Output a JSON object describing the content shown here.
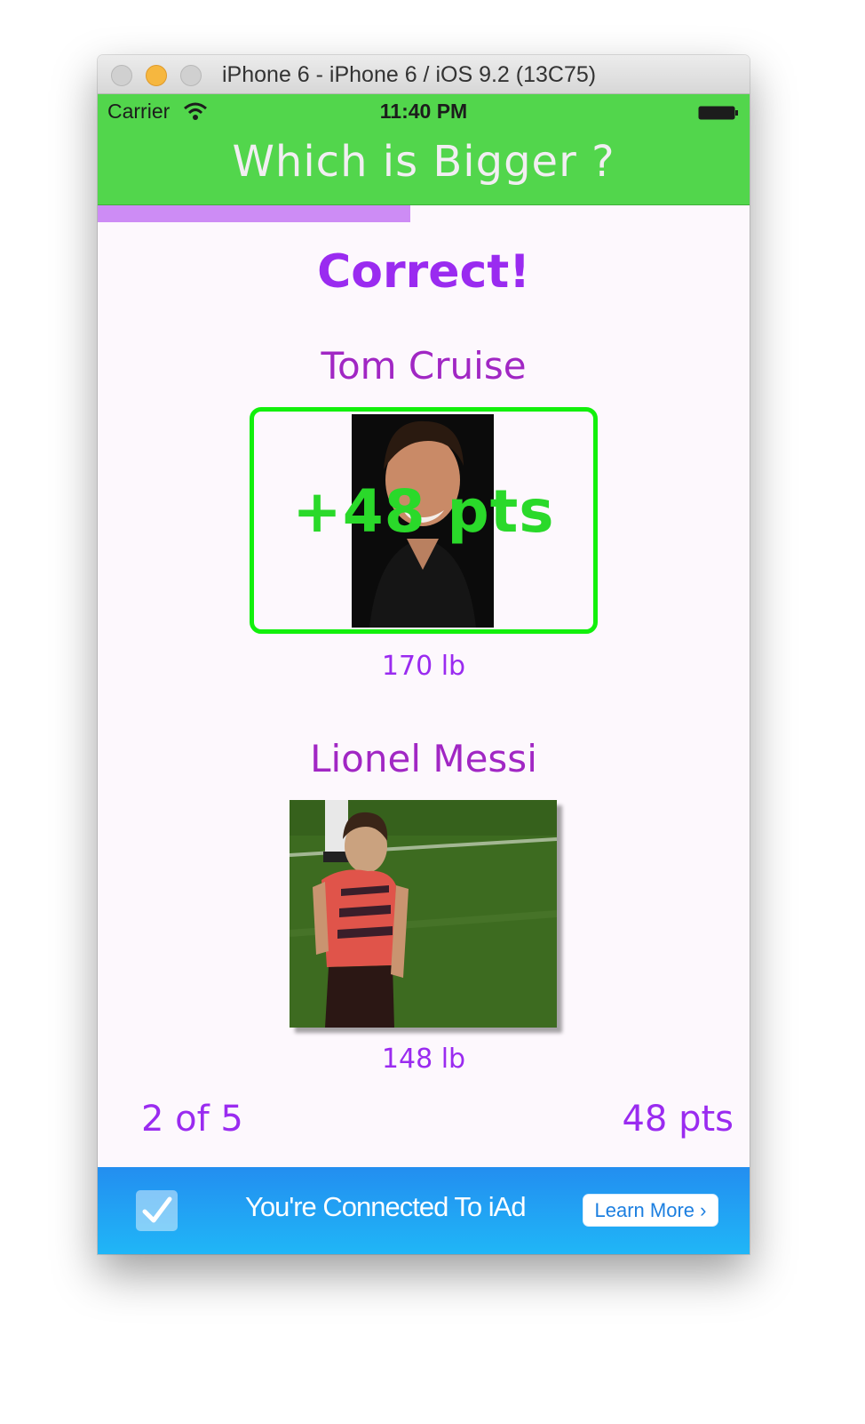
{
  "window": {
    "title": "iPhone 6 - iPhone 6 / iOS 9.2 (13C75)"
  },
  "status_bar": {
    "carrier": "Carrier",
    "time": "11:40 PM"
  },
  "nav": {
    "title": "Which is Bigger ?"
  },
  "progress": {
    "fraction": 0.48
  },
  "game": {
    "result": "Correct!",
    "first": {
      "name": "Tom Cruise",
      "weight": "170 lb",
      "points_awarded": "+48 pts"
    },
    "second": {
      "name": "Lionel Messi",
      "weight": "148 lb"
    },
    "question_counter": "2 of 5",
    "score": "48 pts"
  },
  "ad": {
    "message": "You're Connected To iAd",
    "button_label": "Learn More"
  },
  "colors": {
    "accent_green": "#52d64c",
    "accent_purple": "#9a2bf0",
    "frame_green": "#12f00c",
    "progress_purple": "#cd8cf5"
  }
}
